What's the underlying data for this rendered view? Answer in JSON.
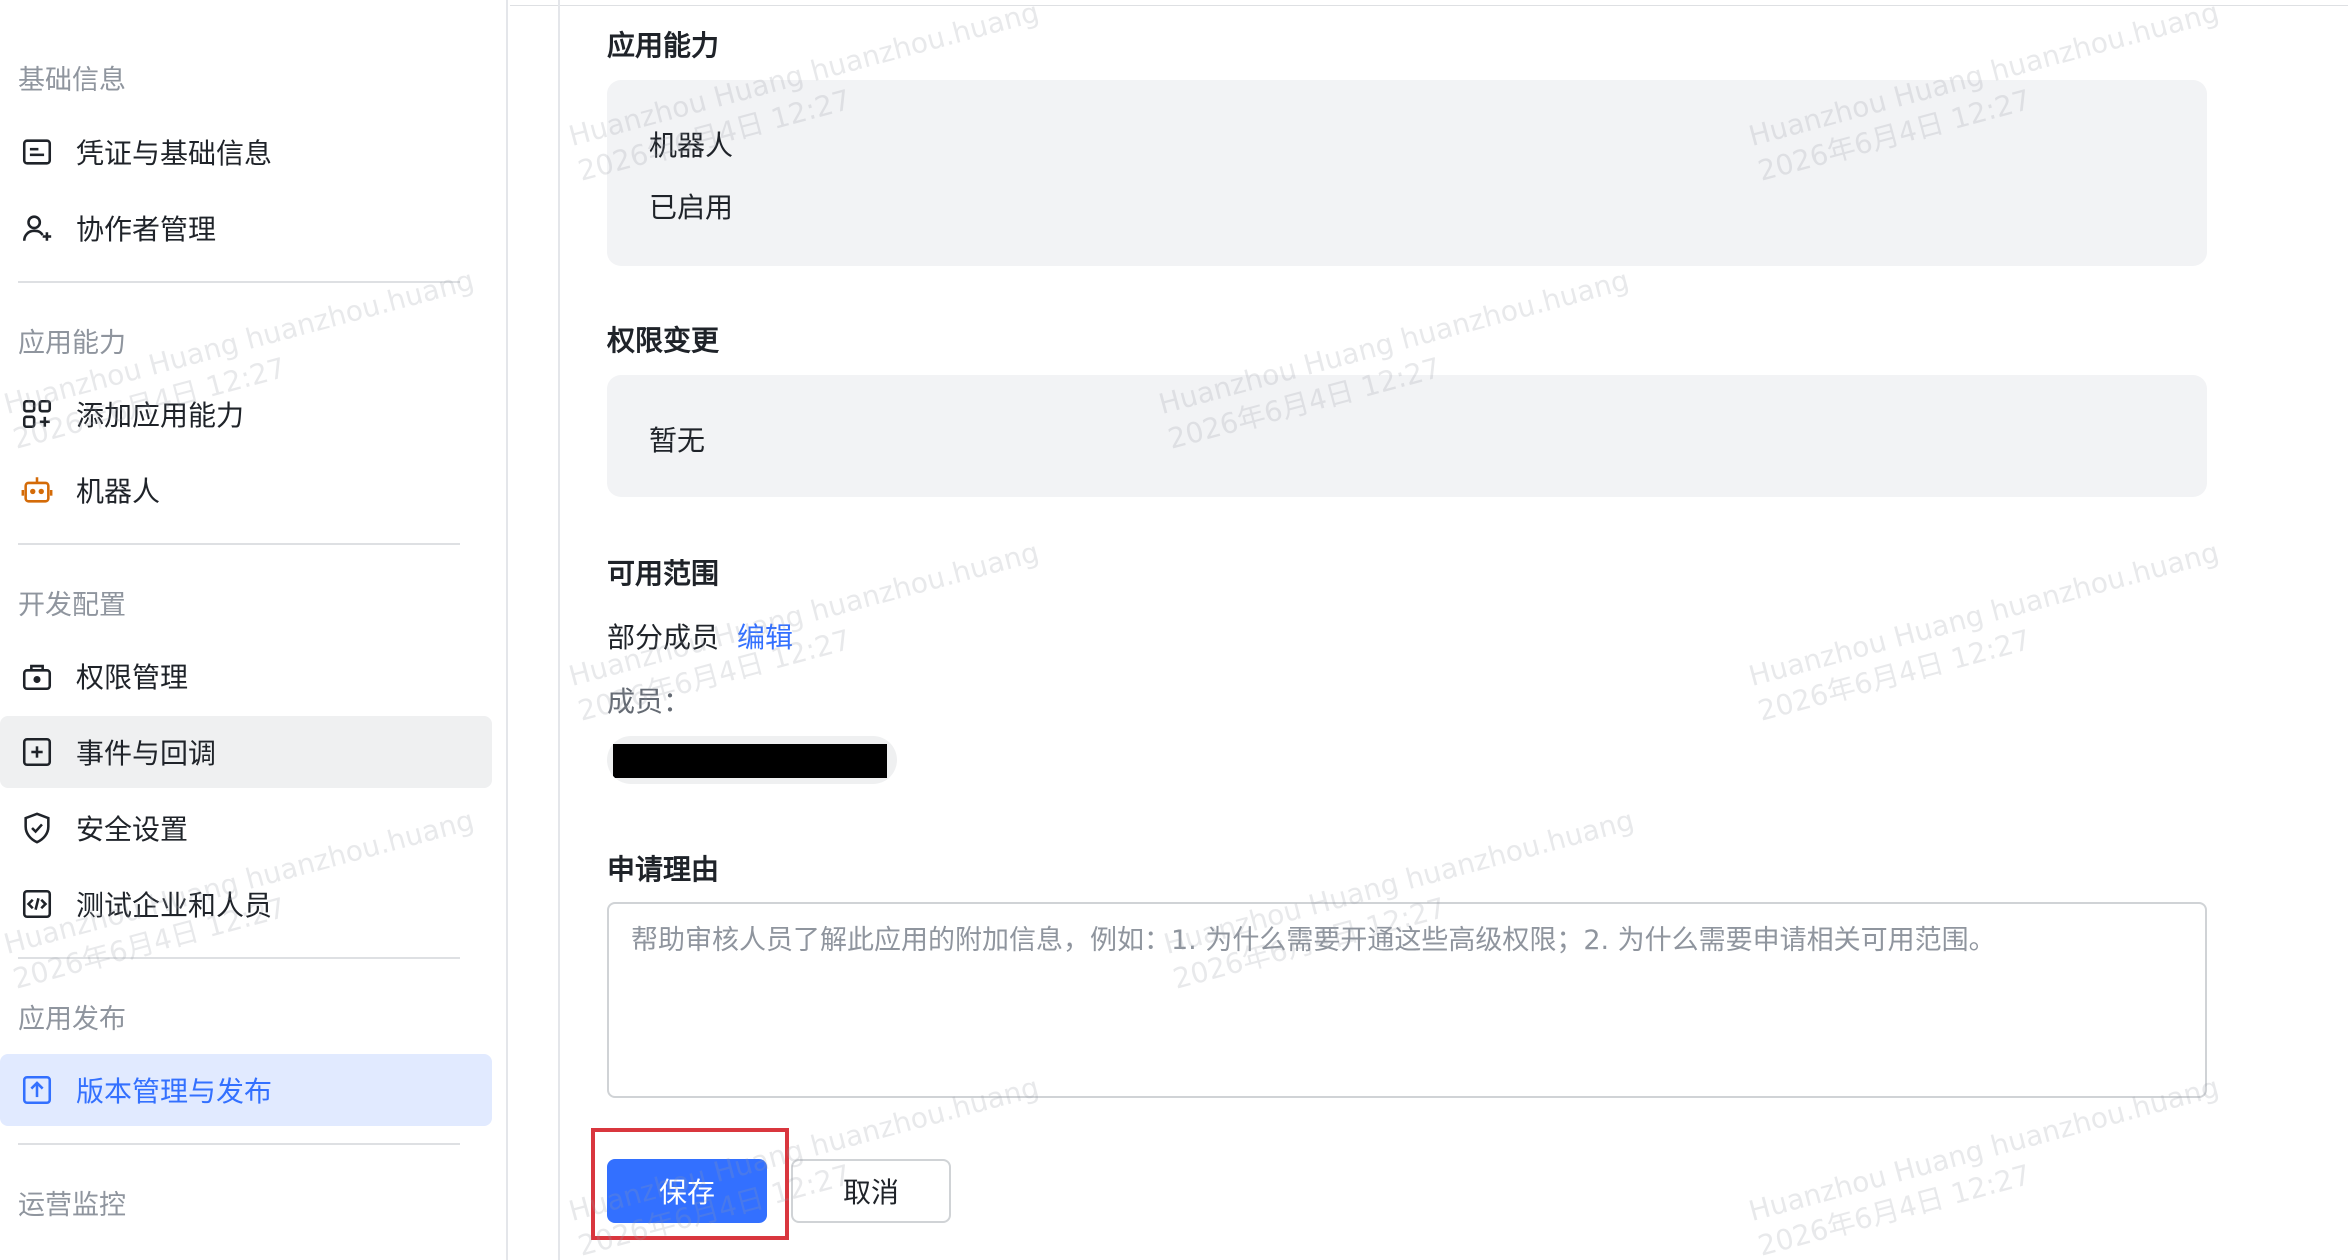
{
  "sidebar": {
    "sections": [
      {
        "title": "基础信息",
        "items": [
          {
            "label": "凭证与基础信息",
            "icon": "credential-card-icon"
          },
          {
            "label": "协作者管理",
            "icon": "user-add-icon"
          }
        ]
      },
      {
        "title": "应用能力",
        "items": [
          {
            "label": "添加应用能力",
            "icon": "app-grid-add-icon"
          },
          {
            "label": "机器人",
            "icon": "robot-icon"
          }
        ]
      },
      {
        "title": "开发配置",
        "items": [
          {
            "label": "权限管理",
            "icon": "permission-lock-icon"
          },
          {
            "label": "事件与回调",
            "icon": "event-plus-icon"
          },
          {
            "label": "安全设置",
            "icon": "shield-check-icon"
          },
          {
            "label": "测试企业和人员",
            "icon": "code-test-icon"
          }
        ]
      },
      {
        "title": "应用发布",
        "items": [
          {
            "label": "版本管理与发布",
            "icon": "upload-version-icon",
            "active": true
          }
        ]
      },
      {
        "title": "运营监控",
        "items": []
      }
    ]
  },
  "main": {
    "capability": {
      "title": "应用能力",
      "name": "机器人",
      "status": "已启用"
    },
    "permission_change": {
      "title": "权限变更",
      "value": "暂无"
    },
    "scope": {
      "title": "可用范围",
      "value": "部分成员",
      "edit_label": "编辑",
      "members_label": "成员："
    },
    "reason": {
      "title": "申请理由",
      "placeholder": "帮助审核人员了解此应用的附加信息，例如：1. 为什么需要开通这些高级权限；2. 为什么需要申请相关可用范围。"
    },
    "actions": {
      "save_label": "保存",
      "cancel_label": "取消"
    }
  },
  "watermark": {
    "line1": "Huanzhou Huang huanzhou.huang",
    "line2": "2026年6月4日 12:27"
  },
  "colors": {
    "accent": "#3370ff",
    "active_bg": "#e1eaff",
    "highlight_border": "#d9363e",
    "robot_icon": "#d46b08"
  }
}
